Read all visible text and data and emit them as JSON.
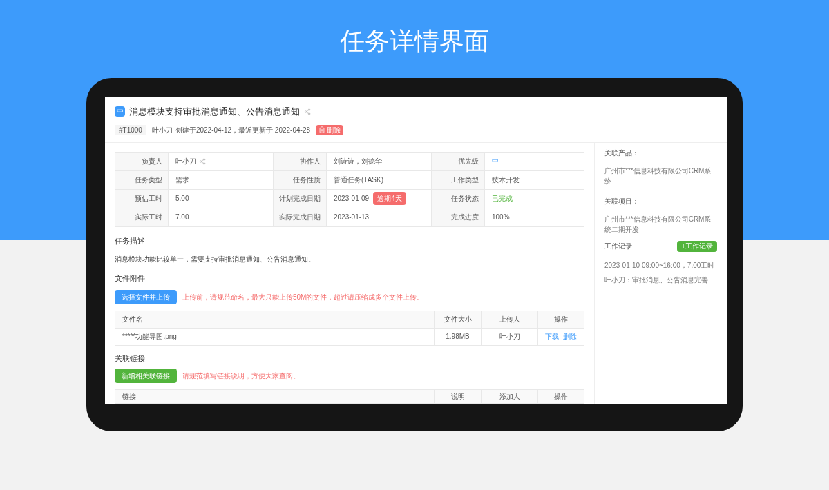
{
  "page_title": "任务详情界面",
  "task": {
    "priority_badge": "中",
    "title": "消息模块支持审批消息通知、公告消息通知",
    "id": "#T1000",
    "owner": "叶小刀",
    "meta": "创建于2022-04-12，最近更新于 2022-04-28",
    "delete_button": "删除"
  },
  "info_fields": [
    {
      "label": "负责人",
      "value": "叶小刀",
      "kind": "person"
    },
    {
      "label": "协作人",
      "value": "刘诗诗，刘德华",
      "kind": "text"
    },
    {
      "label": "优先级",
      "value": "中",
      "kind": "priority"
    },
    {
      "label": "任务类型",
      "value": "需求",
      "kind": "text"
    },
    {
      "label": "任务性质",
      "value": "普通任务(TASK)",
      "kind": "text"
    },
    {
      "label": "工作类型",
      "value": "技术开发",
      "kind": "text"
    },
    {
      "label": "预估工时",
      "value": "5.00",
      "kind": "text"
    },
    {
      "label": "计划完成日期",
      "value": "2023-01-09",
      "kind": "overdue",
      "badge": "逾期4天"
    },
    {
      "label": "任务状态",
      "value": "已完成",
      "kind": "status"
    },
    {
      "label": "实际工时",
      "value": "7.00",
      "kind": "text"
    },
    {
      "label": "实际完成日期",
      "value": "2023-01-13",
      "kind": "text"
    },
    {
      "label": "完成进度",
      "value": "100%",
      "kind": "text"
    }
  ],
  "description": {
    "title": "任务描述",
    "text": "消息模块功能比较单一，需要支持审批消息通知、公告消息通知。"
  },
  "attachments": {
    "title": "文件附件",
    "upload_button": "选择文件并上传",
    "hint": "上传前，请规范命名，最大只能上传50M的文件，超过请压缩成多个文件上传。",
    "columns": [
      "文件名",
      "文件大小",
      "上传人",
      "操作"
    ],
    "rows": [
      {
        "cells": [
          "*****功能导图.png",
          "1.98MB",
          "叶小刀"
        ],
        "actions": [
          "下载",
          "删除"
        ]
      }
    ]
  },
  "links": {
    "title": "关联链接",
    "add_button": "新增相关联链接",
    "hint": "请规范填写链接说明，方便大家查阅。",
    "columns": [
      "链接",
      "说明",
      "添加人",
      "操作"
    ]
  },
  "sidebar": {
    "product_label": "关联产品：",
    "product": "广州市***信息科技有限公司CRM系统",
    "project_label": "关联项目：",
    "project": "广州市***信息科技有限公司CRM系统二期开发",
    "worklog_title": "工作记录",
    "worklog_button": "+工作记录",
    "entries": [
      {
        "time": "2023-01-10 09:00~16:00，7.00工时",
        "note": "叶小刀：审批消息、公告消息完善"
      }
    ]
  }
}
